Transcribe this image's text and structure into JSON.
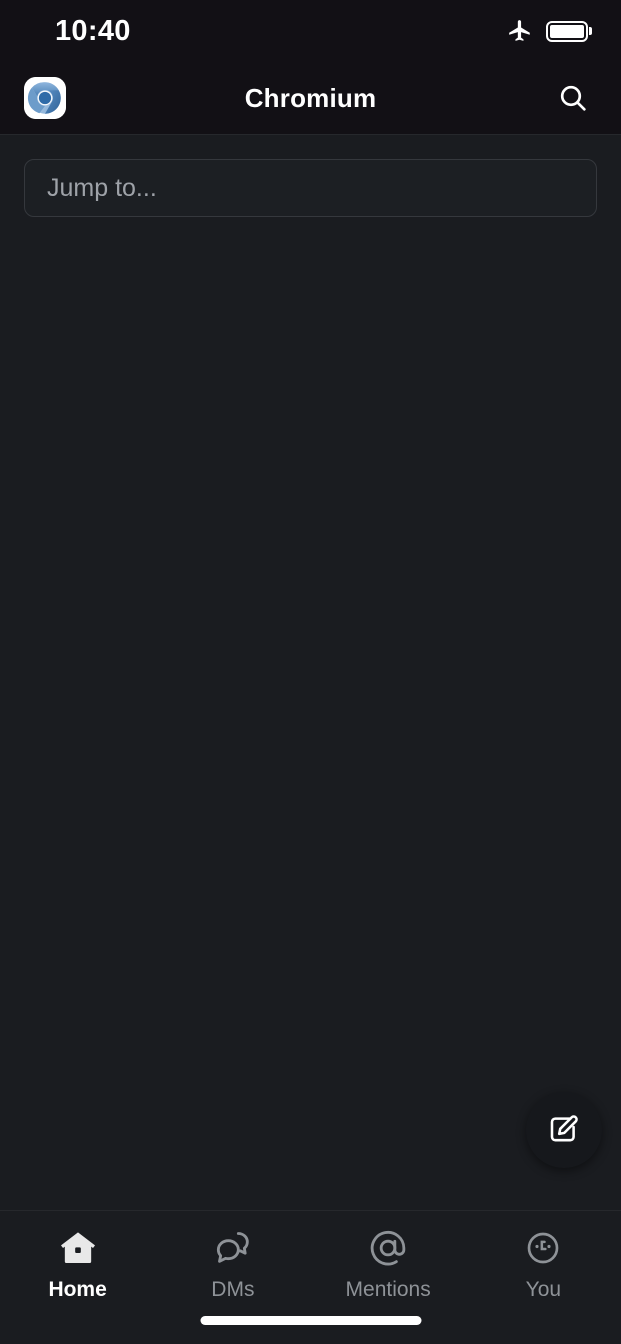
{
  "status_bar": {
    "time": "10:40",
    "airplane_icon": "airplane-mode-icon",
    "battery_icon": "battery-full-icon",
    "battery_level_percent": 100
  },
  "header": {
    "app_icon": "chromium-logo-icon",
    "title": "Chromium",
    "search_icon": "search-icon"
  },
  "main": {
    "jump_to": {
      "placeholder": "Jump to...",
      "value": ""
    },
    "channel_items": [],
    "compose_button": {
      "icon": "compose-pencil-icon",
      "label": "Compose"
    }
  },
  "bottom_nav": {
    "items": [
      {
        "label": "Home",
        "icon": "home-icon",
        "active": true
      },
      {
        "label": "DMs",
        "icon": "dms-icon",
        "active": false
      },
      {
        "label": "Mentions",
        "icon": "mentions-at-icon",
        "active": false
      },
      {
        "label": "You",
        "icon": "you-avatar-icon",
        "active": false
      }
    ]
  },
  "colors": {
    "status_bar_bg": "#121015",
    "header_bg": "#121015",
    "content_bg": "#1a1c20",
    "nav_bg": "#1a1c20",
    "divider": "#26282c",
    "text_primary": "#ffffff",
    "text_muted": "#8e9297",
    "placeholder": "#9ea2a8",
    "fab_bg": "#16181c",
    "input_border": "#35383d"
  }
}
